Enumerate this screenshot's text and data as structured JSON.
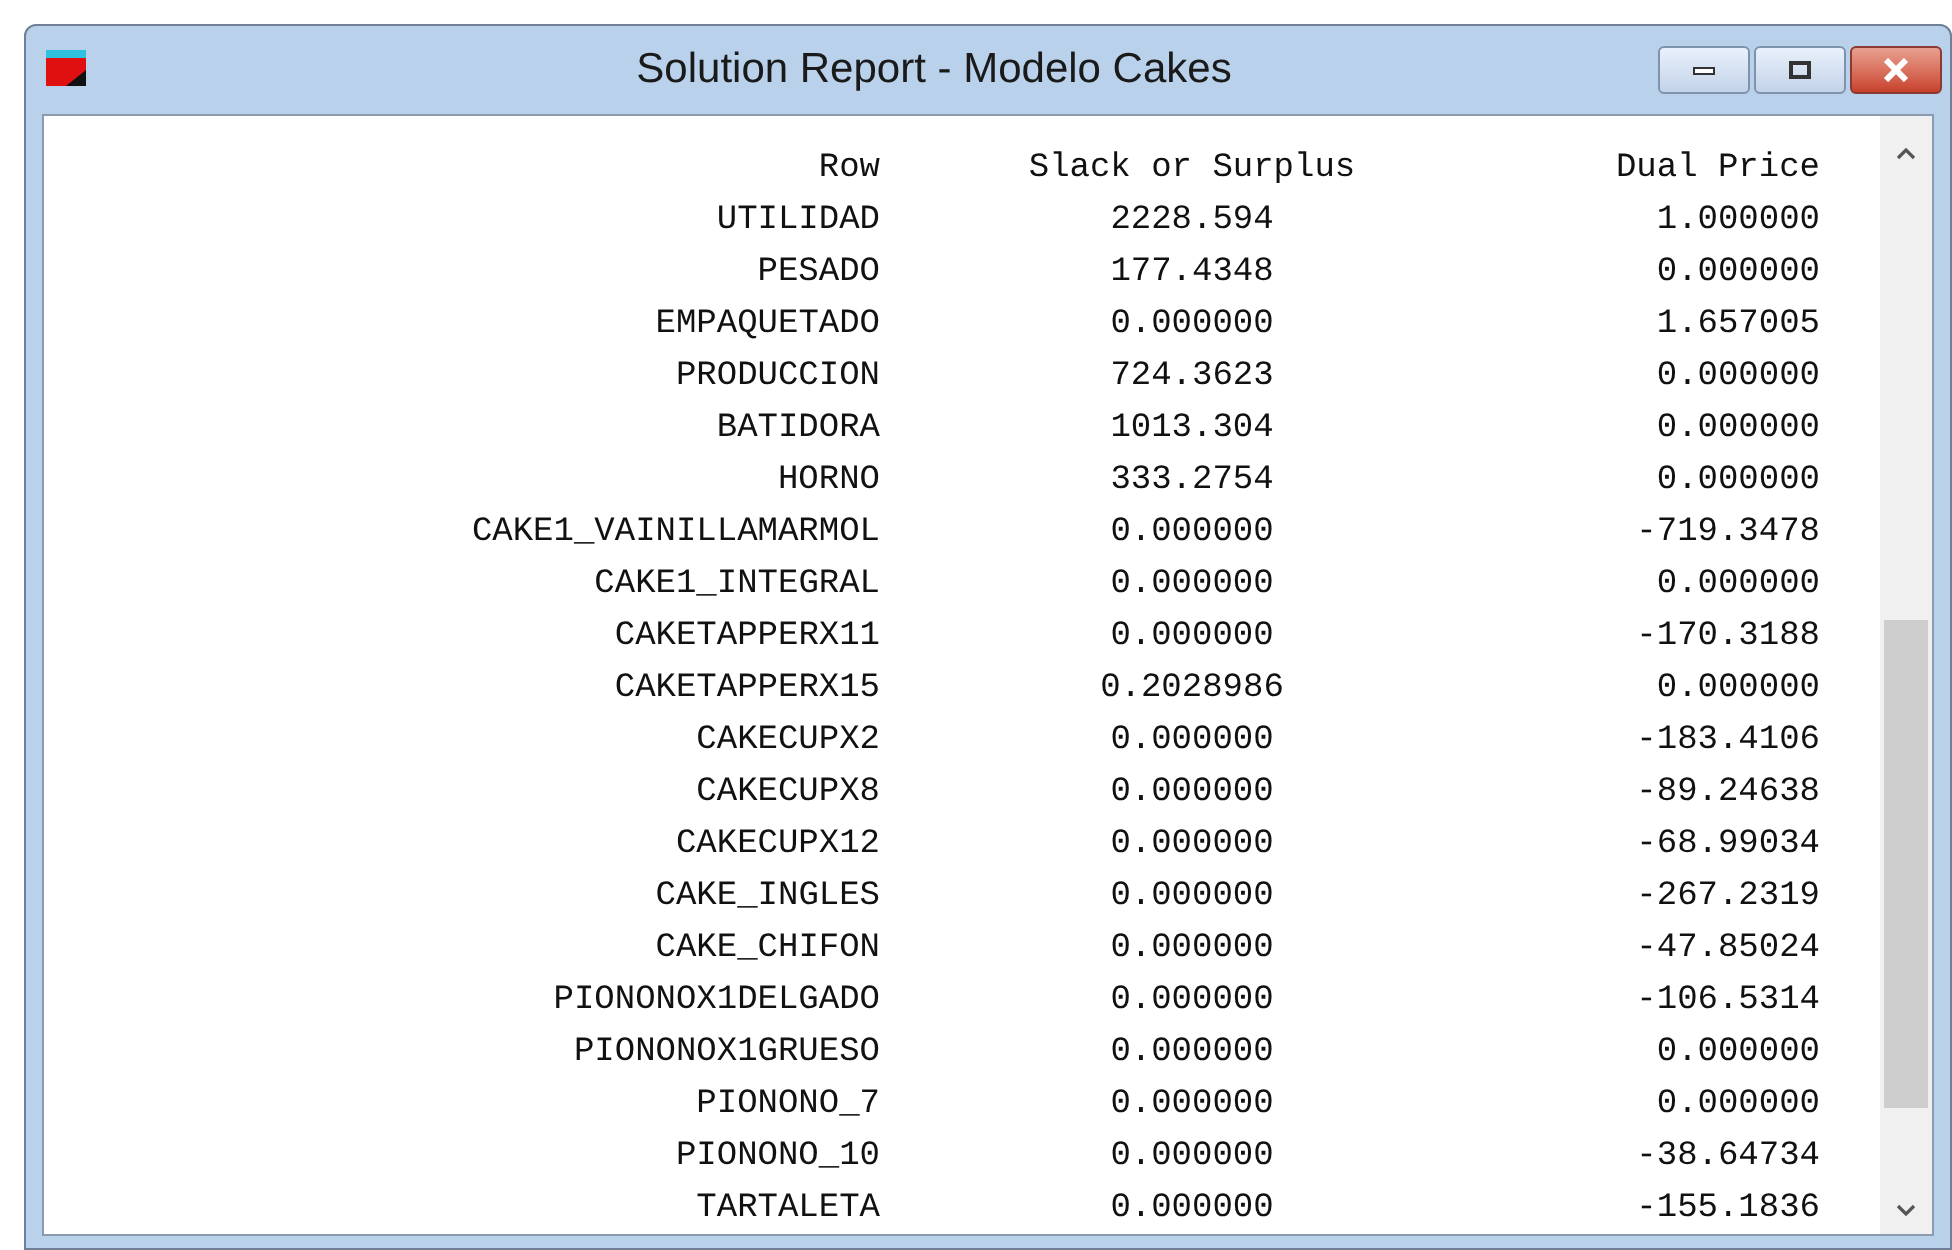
{
  "window": {
    "title": "Solution Report - Modelo Cakes"
  },
  "table": {
    "columns": [
      "Row",
      "Slack or Surplus",
      "Dual Price"
    ],
    "rows": [
      [
        "UTILIDAD",
        "2228.594",
        "1.000000"
      ],
      [
        "PESADO",
        "177.4348",
        "0.000000"
      ],
      [
        "EMPAQUETADO",
        "0.000000",
        "1.657005"
      ],
      [
        "PRODUCCION",
        "724.3623",
        "0.000000"
      ],
      [
        "BATIDORA",
        "1013.304",
        "0.000000"
      ],
      [
        "HORNO",
        "333.2754",
        "0.000000"
      ],
      [
        "CAKE1_VAINILLAMARMOL",
        "0.000000",
        "-719.3478"
      ],
      [
        "CAKE1_INTEGRAL",
        "0.000000",
        "0.000000"
      ],
      [
        "CAKETAPPERX11",
        "0.000000",
        "-170.3188"
      ],
      [
        "CAKETAPPERX15",
        "0.2028986",
        "0.000000"
      ],
      [
        "CAKECUPX2",
        "0.000000",
        "-183.4106"
      ],
      [
        "CAKECUPX8",
        "0.000000",
        "-89.24638"
      ],
      [
        "CAKECUPX12",
        "0.000000",
        "-68.99034"
      ],
      [
        "CAKE_INGLES",
        "0.000000",
        "-267.2319"
      ],
      [
        "CAKE_CHIFON",
        "0.000000",
        "-47.85024"
      ],
      [
        "PIONONOX1DELGADO",
        "0.000000",
        "-106.5314"
      ],
      [
        "PIONONOX1GRUESO",
        "0.000000",
        "0.000000"
      ],
      [
        "PIONONO_7",
        "0.000000",
        "0.000000"
      ],
      [
        "PIONONO_10",
        "0.000000",
        "-38.64734"
      ],
      [
        "TARTALETA",
        "0.000000",
        "-155.1836"
      ]
    ]
  }
}
